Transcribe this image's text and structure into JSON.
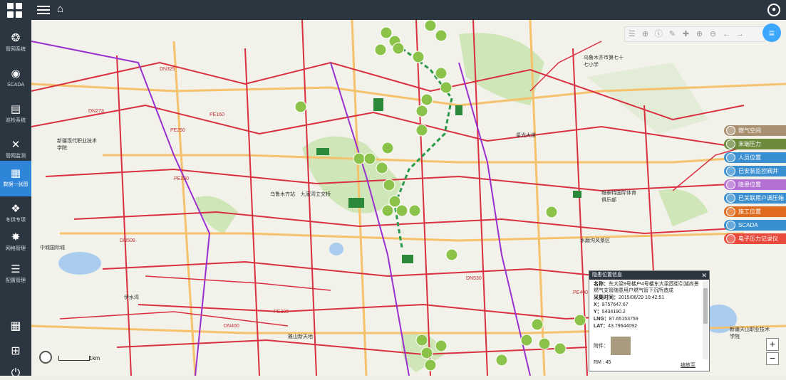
{
  "nav": {
    "items": [
      {
        "label": "管网系统",
        "icon": "globe-icon"
      },
      {
        "label": "SCADA",
        "icon": "gauge-icon"
      },
      {
        "label": "巡检系统",
        "icon": "clipboard-icon"
      },
      {
        "label": "管网监测",
        "icon": "tools-icon"
      },
      {
        "label": "数据一张图",
        "icon": "map-icon"
      },
      {
        "label": "冬供专项",
        "icon": "snowflake-icon"
      },
      {
        "label": "网格管理",
        "icon": "cog-icon"
      },
      {
        "label": "配置管理",
        "icon": "sliders-icon"
      }
    ],
    "active_index": 4
  },
  "toolbar": {
    "icons": [
      "layer-icon",
      "zoom-full-icon",
      "info-icon",
      "measure-icon",
      "add-icon",
      "zoom-in-icon",
      "zoom-out-icon",
      "back-icon",
      "forward-icon"
    ],
    "list_icon": "list-icon"
  },
  "layers": [
    {
      "label": "燃气空间",
      "color": "#a89070"
    },
    {
      "label": "末端压力",
      "color": "#6b8a3c"
    },
    {
      "label": "人员位置",
      "color": "#3a8fd0"
    },
    {
      "label": "已安装监控阀井",
      "color": "#3a8fd0"
    },
    {
      "label": "隐患位置",
      "color": "#b36fd2"
    },
    {
      "label": "已关联用户调压箱",
      "color": "#3a8fd0"
    },
    {
      "label": "施工位置",
      "color": "#e06a1e"
    },
    {
      "label": "SCADA",
      "color": "#3a8fd0"
    },
    {
      "label": "电子压力记录仪",
      "color": "#e84a3c"
    }
  ],
  "popup": {
    "title": "隐患位置信息",
    "name_label": "名称：",
    "name_value": "东大梁9号楼户4号楼东大梁西街引湖尚景燃气支管随意用户燃气管下沉所造成",
    "time_label": "采集时间：",
    "time_value": "2015/06/29 10:42:51",
    "x_label": "X：",
    "x_value": "9757647.67",
    "y_label": "Y：",
    "y_value": "5434190.2",
    "lng_label": "LNG：",
    "lng_value": "87.65153759",
    "lat_label": "LAT：",
    "lat_value": "43.79644092",
    "attach_label": "附件：",
    "more_label": "编放至",
    "rn": "RM : 45"
  },
  "map_labels": {
    "scale": "1km",
    "places": [
      "乌鲁木齐站",
      "九家湾立交桥",
      "新疆现代职业技术学院",
      "伊水湾",
      "中城国际城",
      "雅山新天地",
      "新疆天山职业技术学院",
      "乌鲁木齐市第七十七小学",
      "维泰特国际体育俱乐部",
      "水磨沟风景区",
      "星光大道"
    ],
    "roads": [
      "DN325",
      "DN273",
      "PE160",
      "PE200",
      "PE250",
      "DN508",
      "DN400",
      "PE300",
      "DN530",
      "PE400"
    ]
  },
  "zoom": {
    "in": "+",
    "out": "−"
  }
}
